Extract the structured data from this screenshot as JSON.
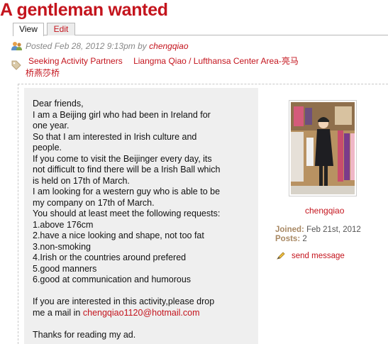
{
  "title": "A gentleman wanted",
  "tabs": {
    "view": "View",
    "edit": "Edit"
  },
  "meta": {
    "posted": "Posted Feb 28, 2012 9:13pm by",
    "author": "chengqiao"
  },
  "tags": {
    "category": "Seeking Activity Partners",
    "location_1": "Liangma Qiao / Lufthansa Center Area-亮马",
    "location_2": "桥燕莎桥"
  },
  "post": {
    "lines": [
      "Dear friends,",
      "I am a Beijing girl who had been in Ireland for",
      "one year.",
      "So that I am interested in Irish culture and",
      "people.",
      "If you come to visit the Beijinger every day, its",
      "not difficult to find there will be a Irish Ball which",
      "is held on 17th of March.",
      "I am looking for a western guy who is able to be",
      "my company on 17th of March.",
      "You should at least meet the following requests:",
      "1.above 176cm",
      "2.have a nice looking and shape, not too fat",
      "3.non-smoking",
      "4.Irish or the countries around prefered",
      "5.good manners",
      "6.good at communication and humorous"
    ],
    "contact_line_1": "If you are interested in this activity,please drop",
    "contact_prefix": "me a mail in",
    "email": "chengqiao1120@hotmail.com",
    "closing": "Thanks for reading my ad."
  },
  "sidebar": {
    "username": "chengqiao",
    "joined_label": "Joined:",
    "joined_value": "Feb 21st, 2012",
    "posts_label": "Posts:",
    "posts_value": "2",
    "send_message": "send message"
  },
  "icons": {
    "user": "user-group-icon",
    "tag": "tag-icon",
    "message": "message-icon"
  },
  "colors": {
    "accent": "#c4141d",
    "meta_label": "#a88863",
    "panel_bg": "#efefef"
  }
}
